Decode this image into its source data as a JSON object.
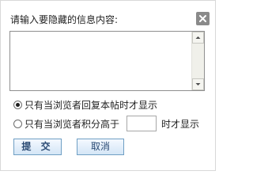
{
  "dialog": {
    "prompt": "请输入要隐藏的信息内容:",
    "close_icon": "close-x-icon",
    "content_value": ""
  },
  "options": [
    {
      "label": "只有当浏览者回复本帖时才显示",
      "checked": true
    },
    {
      "label": "只有当浏览者积分高于",
      "checked": false
    }
  ],
  "score": {
    "value": "",
    "suffix": "时才显示"
  },
  "buttons": {
    "submit": "提 交",
    "cancel": "取消"
  },
  "colors": {
    "button_border": "#6f9fc4",
    "button_text": "#2a4a73",
    "close_button_bg": "#8a8a8a"
  }
}
